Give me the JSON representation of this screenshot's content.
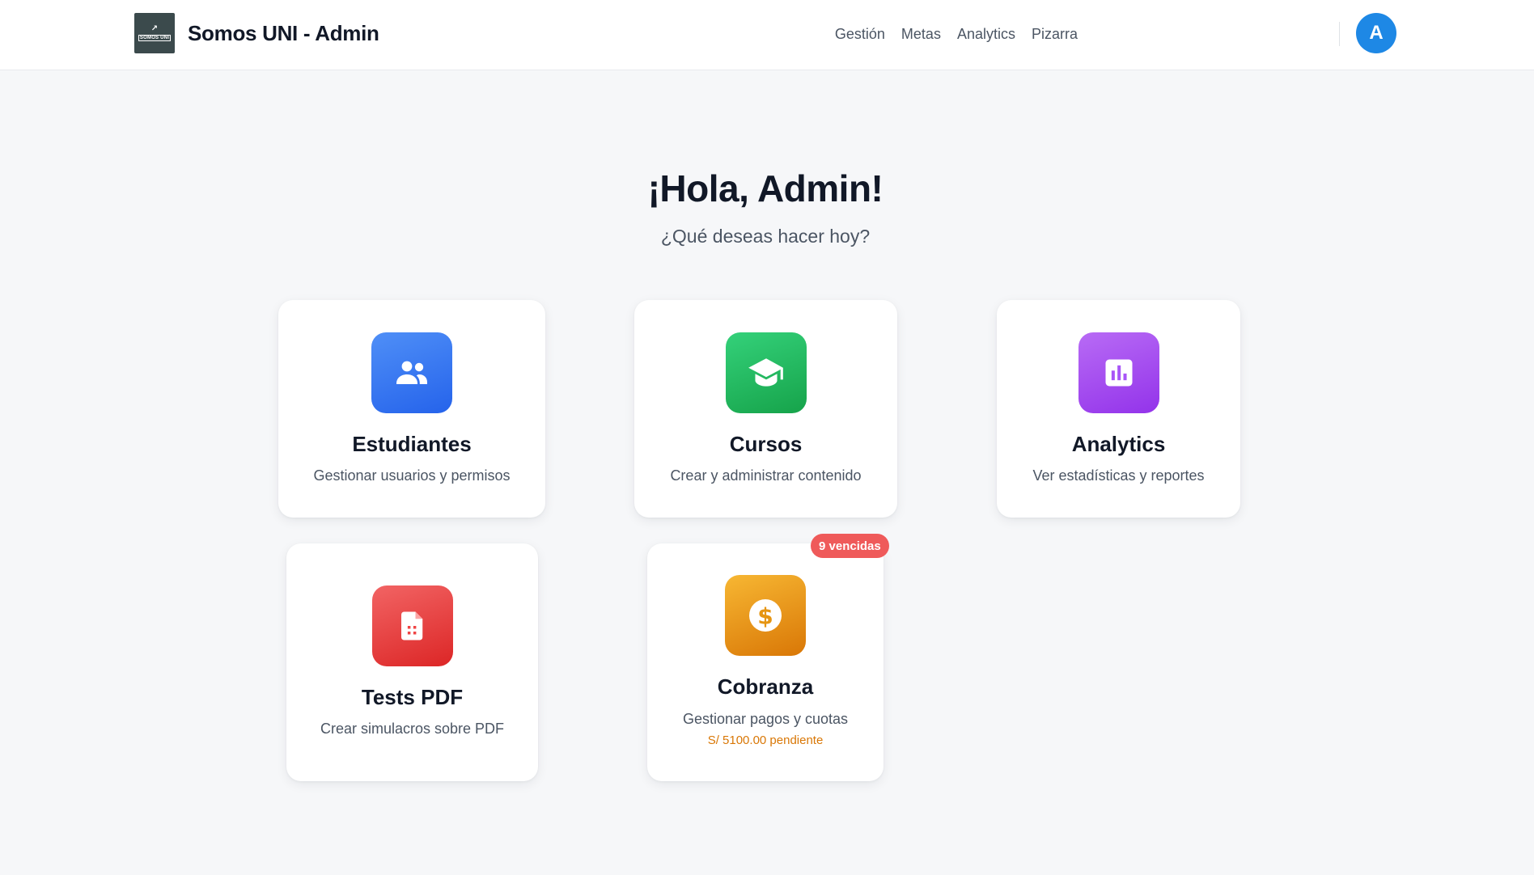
{
  "header": {
    "title": "Somos UNI - Admin",
    "logo_text": "SOMOS UNI",
    "nav": [
      "Gestión",
      "Metas",
      "Analytics",
      "Pizarra"
    ],
    "avatar_initial": "A"
  },
  "hero": {
    "greeting": "¡Hola, Admin!",
    "subtitle": "¿Qué deseas hacer hoy?"
  },
  "cards": [
    {
      "title": "Estudiantes",
      "description": "Gestionar usuarios y permisos",
      "icon": "users-icon",
      "color": "#3b82f6"
    },
    {
      "title": "Cursos",
      "description": "Crear y administrar contenido",
      "icon": "graduation-cap-icon",
      "color": "#22c55e"
    },
    {
      "title": "Analytics",
      "description": "Ver estadísticas y reportes",
      "icon": "bar-chart-icon",
      "color": "#a855f7"
    },
    {
      "title": "Tests PDF",
      "description": "Crear simulacros sobre PDF",
      "icon": "pdf-file-icon",
      "color": "#ef4444"
    },
    {
      "title": "Cobranza",
      "description": "Gestionar pagos y cuotas",
      "icon": "dollar-coin-icon",
      "color": "#f59e0b",
      "extra": "S/ 5100.00 pendiente",
      "badge": "9 vencidas",
      "badge_color": "#ef5a5a"
    }
  ]
}
